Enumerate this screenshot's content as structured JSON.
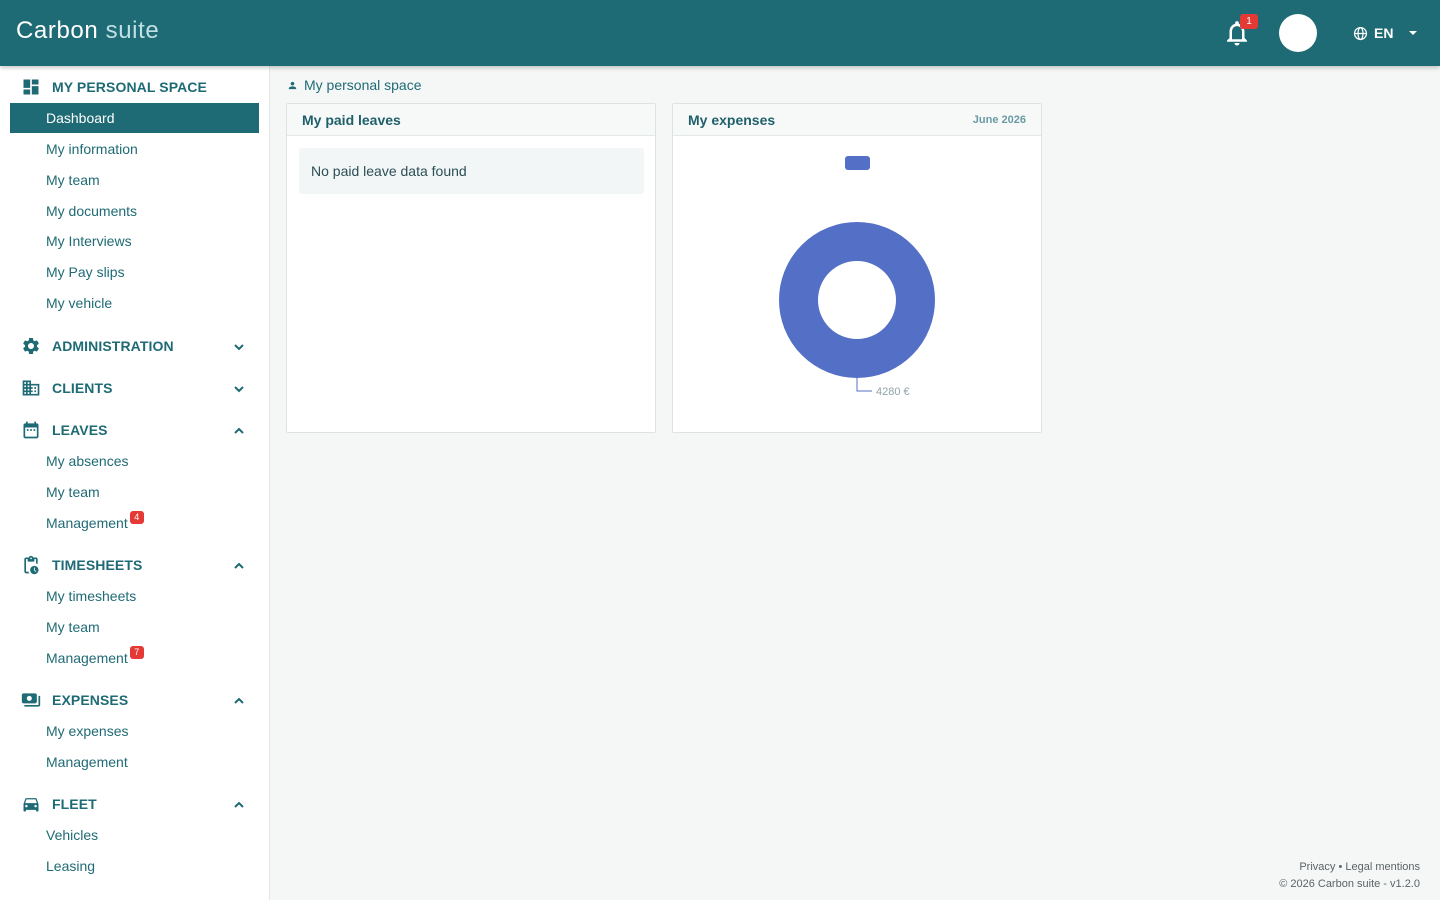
{
  "header": {
    "brand_part1": "Carbon",
    "brand_part2": "suite",
    "notification_count": "1",
    "language": "EN"
  },
  "sidebar": {
    "personal": {
      "title": "MY PERSONAL SPACE",
      "items": [
        "Dashboard",
        "My information",
        "My team",
        "My documents",
        "My Interviews",
        "My Pay slips",
        "My vehicle"
      ]
    },
    "administration": {
      "title": "ADMINISTRATION"
    },
    "clients": {
      "title": "CLIENTS"
    },
    "leaves": {
      "title": "LEAVES",
      "items": [
        "My absences",
        "My team",
        "Management"
      ],
      "management_badge": "4"
    },
    "timesheets": {
      "title": "TIMESHEETS",
      "items": [
        "My timesheets",
        "My team",
        "Management"
      ],
      "management_badge": "7"
    },
    "expenses": {
      "title": "EXPENSES",
      "items": [
        "My expenses",
        "Management"
      ]
    },
    "fleet": {
      "title": "FLEET",
      "items": [
        "Vehicles",
        "Leasing"
      ]
    }
  },
  "breadcrumb": {
    "label": "My personal space"
  },
  "paid_leaves": {
    "title": "My paid leaves",
    "empty_text": "No paid leave data found"
  },
  "expenses_card": {
    "title": "My expenses",
    "period": "June 2026"
  },
  "chart_data": {
    "type": "pie",
    "values": [
      4280
    ],
    "data_labels": [
      "4280 €"
    ],
    "colors": [
      "#5470c6"
    ],
    "legend_placement": "top"
  },
  "footer": {
    "privacy": "Privacy",
    "separator": "•",
    "legal": "Legal mentions",
    "copyright": "© 2026 Carbon suite - v1.2.0"
  },
  "colors": {
    "primary": "#1f6b75",
    "badge": "#e53935",
    "chart_series": "#5470c6"
  }
}
